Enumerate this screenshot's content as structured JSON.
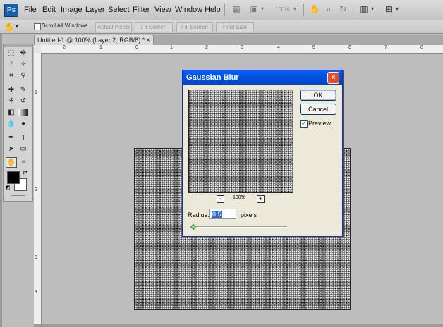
{
  "app": {
    "logo_text": "Ps"
  },
  "menu": [
    "File",
    "Edit",
    "Image",
    "Layer",
    "Select",
    "Filter",
    "View",
    "Window",
    "Help"
  ],
  "toolbar": {
    "zoom_label": "100%"
  },
  "options_bar": {
    "scroll_all_label": "Scroll All Windows",
    "actual_pixels": "Actual Pixels",
    "fit_screen": "Fit Screen",
    "fill_screen": "Fill Screen",
    "print_size": "Print Size"
  },
  "document": {
    "tab_title": "Untitled-1 @ 100% (Layer 2, RGB/8) *",
    "close_glyph": "×",
    "ruler_top": [
      "2",
      "1",
      "0",
      "1",
      "2",
      "3",
      "4",
      "5",
      "6",
      "7",
      "8"
    ],
    "ruler_left": [
      "1",
      "2",
      "3",
      "4"
    ]
  },
  "dialog": {
    "title": "Gaussian Blur",
    "close_glyph": "×",
    "ok_label": "OK",
    "cancel_label": "Cancel",
    "preview_label": "Preview",
    "preview_checked": true,
    "zoom_out_glyph": "−",
    "zoom_in_glyph": "+",
    "zoom_level": "100%",
    "radius_label": "Radius:",
    "radius_value": "0.5",
    "radius_unit": "pixels"
  },
  "colors": {
    "dialog_title_bar": "#0a5ffb",
    "workspace": "#bdbdbd",
    "foreground": "#000000",
    "background": "#ffffff"
  },
  "icons": [
    "hand-icon",
    "zoom-icon",
    "rotate-icon",
    "arrange-documents-icon",
    "screen-mode-icon",
    "marquee-icon",
    "move-icon",
    "lasso-icon",
    "magic-wand-icon",
    "crop-icon",
    "eyedropper-icon",
    "healing-brush-icon",
    "brush-icon",
    "clone-stamp-icon",
    "history-brush-icon",
    "eraser-icon",
    "gradient-icon",
    "blur-icon",
    "dodge-icon",
    "pen-icon",
    "type-icon",
    "path-selection-icon",
    "shape-icon"
  ]
}
